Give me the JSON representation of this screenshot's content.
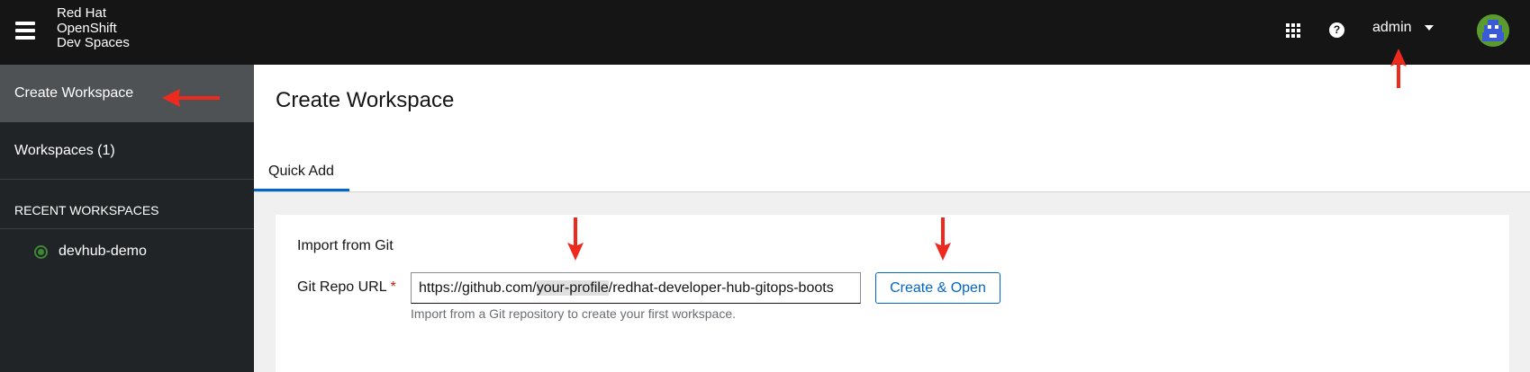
{
  "masthead": {
    "brand_line1": "Red Hat",
    "brand_line2": "OpenShift",
    "brand_line3": "Dev Spaces",
    "apps_icon": "grid-icon",
    "help_icon": "question-circle-icon",
    "user_name": "admin"
  },
  "sidebar": {
    "items": [
      {
        "label": "Create Workspace",
        "active": true
      },
      {
        "label": "Workspaces (1)",
        "active": false
      }
    ],
    "recent_title": "RECENT WORKSPACES",
    "recent": [
      {
        "label": "devhub-demo",
        "status": "running"
      }
    ]
  },
  "main": {
    "title": "Create Workspace",
    "tabs": [
      {
        "label": "Quick Add",
        "active": true
      }
    ],
    "import_title": "Import from Git",
    "repo_label": "Git Repo URL",
    "required_mark": "*",
    "repo_value_prefix": "https://github.com/",
    "repo_value_highlight": "your-profile",
    "repo_value_suffix": "/redhat-developer-hub-gitops-boots",
    "repo_helper": "Import from a Git repository to create your first workspace.",
    "create_button": "Create & Open"
  },
  "colors": {
    "accent": "#0066cc",
    "annotation_arrow": "#ee2a1e",
    "status_running": "#3e8635"
  }
}
